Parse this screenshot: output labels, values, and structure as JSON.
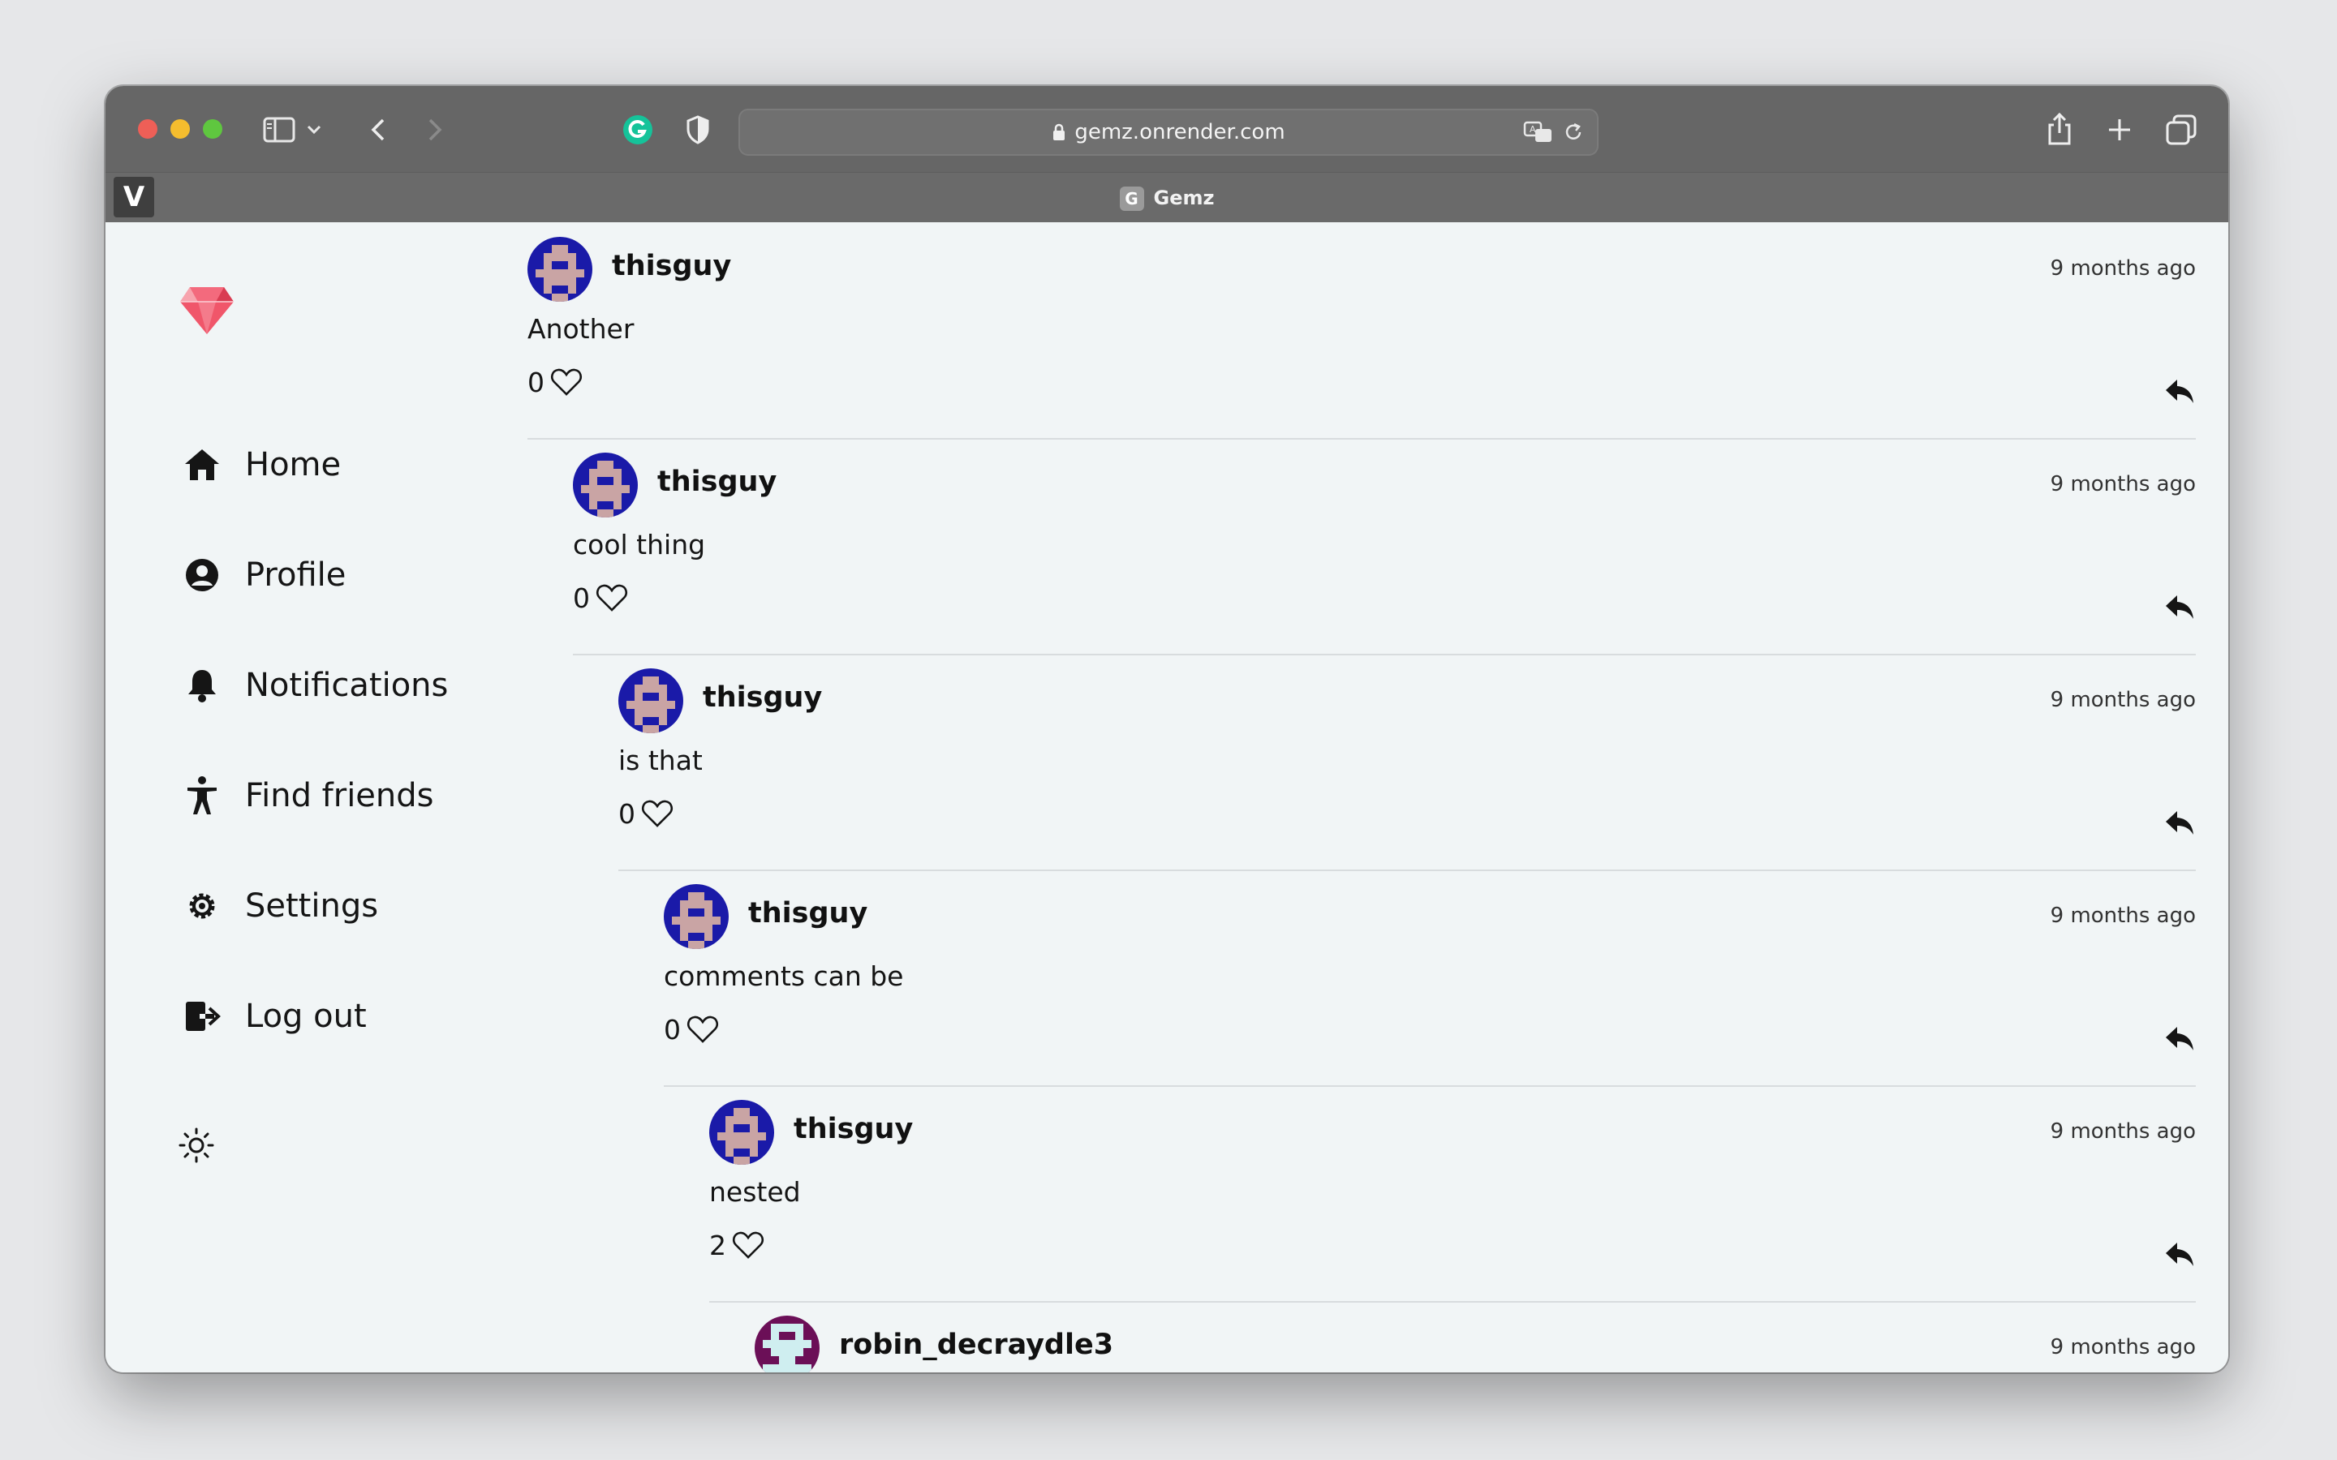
{
  "browser": {
    "url": "gemz.onrender.com",
    "tab_title": "Gemz",
    "tab_favicon_letter": "G",
    "pinned_tab_letter": "V"
  },
  "sidebar": {
    "items": [
      {
        "label": "Home",
        "icon": "home-icon"
      },
      {
        "label": "Profile",
        "icon": "profile-icon"
      },
      {
        "label": "Notifications",
        "icon": "bell-icon"
      },
      {
        "label": "Find friends",
        "icon": "accessibility-person-icon"
      },
      {
        "label": "Settings",
        "icon": "gear-icon"
      },
      {
        "label": "Log out",
        "icon": "logout-icon"
      }
    ],
    "theme_toggle_icon": "sun-icon",
    "logo_icon": "gem-icon"
  },
  "comments": [
    {
      "username": "thisguy",
      "time": "9 months ago",
      "text": "Another",
      "likes": "0"
    },
    {
      "username": "thisguy",
      "time": "9 months ago",
      "text": "cool thing",
      "likes": "0"
    },
    {
      "username": "thisguy",
      "time": "9 months ago",
      "text": "is that",
      "likes": "0"
    },
    {
      "username": "thisguy",
      "time": "9 months ago",
      "text": "comments can be",
      "likes": "0"
    },
    {
      "username": "thisguy",
      "time": "9 months ago",
      "text": "nested",
      "likes": "2"
    },
    {
      "username": "robin_decraydle3",
      "time": "9 months ago",
      "text": "",
      "likes": ""
    }
  ],
  "colors": {
    "accent_gem": "#f0566a",
    "avatar_blue": "#1a1aa8",
    "avatar_purple": "#6b0f57"
  }
}
